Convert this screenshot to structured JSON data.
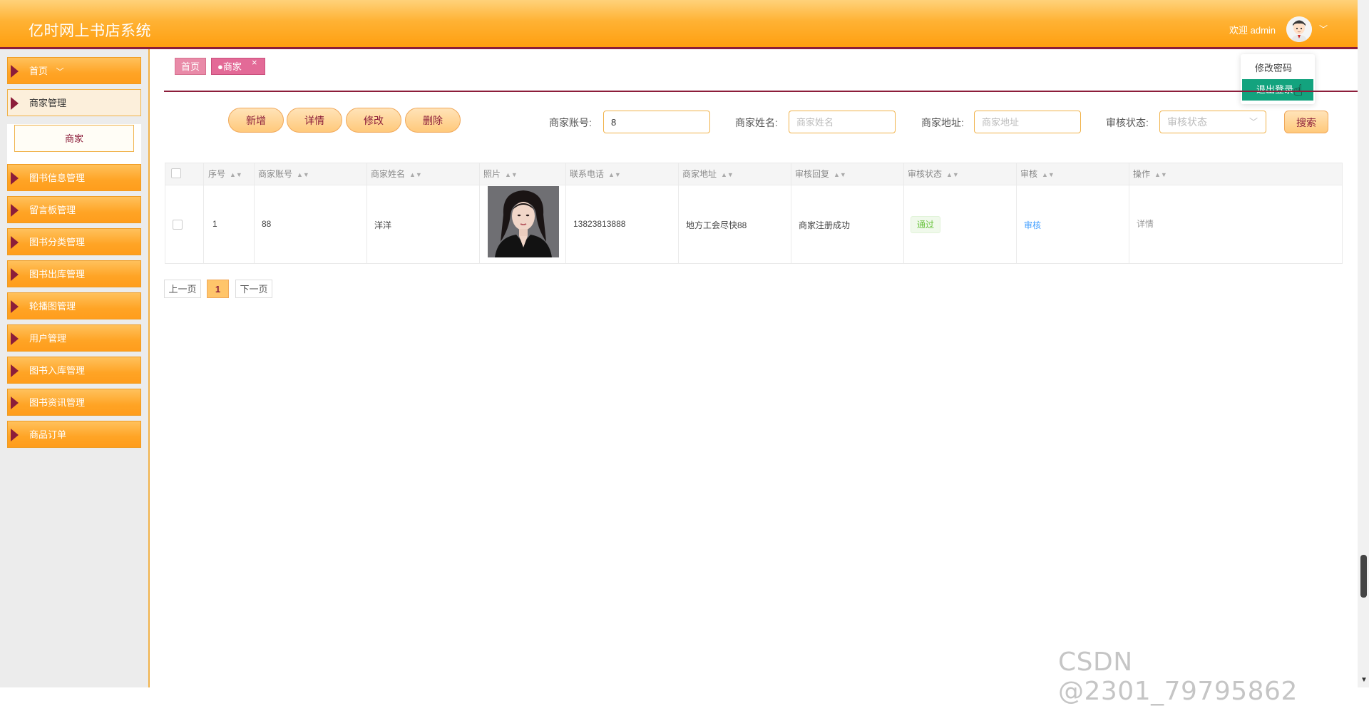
{
  "header": {
    "title": "亿时网上书店系统",
    "welcome": "欢迎 admin",
    "user_menu": {
      "change_password": "修改密码",
      "logout": "退出登录"
    }
  },
  "sidebar": {
    "items": [
      {
        "label": "首页"
      },
      {
        "label": "商家管理",
        "active": true,
        "children": [
          {
            "label": "商家"
          }
        ]
      },
      {
        "label": "图书信息管理"
      },
      {
        "label": "留言板管理"
      },
      {
        "label": "图书分类管理"
      },
      {
        "label": "图书出库管理"
      },
      {
        "label": "轮播图管理"
      },
      {
        "label": "用户管理"
      },
      {
        "label": "图书入库管理"
      },
      {
        "label": "图书资讯管理"
      },
      {
        "label": "商品订单"
      }
    ]
  },
  "tabs": {
    "home": "首页",
    "merchant": "●商家",
    "close": "×"
  },
  "actions": {
    "add": "新增",
    "detail": "详情",
    "edit": "修改",
    "delete": "删除"
  },
  "search": {
    "account_label": "商家账号:",
    "account_value": "8",
    "name_label": "商家姓名:",
    "name_placeholder": "商家姓名",
    "address_label": "商家地址:",
    "address_placeholder": "商家地址",
    "status_label": "审核状态:",
    "status_placeholder": "审核状态",
    "button": "搜索"
  },
  "table": {
    "headers": [
      "序号",
      "商家账号",
      "商家姓名",
      "照片",
      "联系电话",
      "商家地址",
      "审核回复",
      "审核状态",
      "审核",
      "操作"
    ],
    "rows": [
      {
        "index": "1",
        "account": "88",
        "name": "洋洋",
        "phone": "13823813888",
        "address": "地方工会尽快88",
        "reply": "商家注册成功",
        "status": "通过",
        "audit": "审核",
        "op": "详情"
      }
    ]
  },
  "pagination": {
    "prev": "上一页",
    "current": "1",
    "next": "下一页"
  },
  "watermark": "CSDN @2301_79795862",
  "colors": {
    "accent": "#ff9f10",
    "brand_dark": "#8c1d3a",
    "tab_pink": "#e36a97",
    "logout_green": "#13a37e",
    "status_green": "#67c23a"
  }
}
